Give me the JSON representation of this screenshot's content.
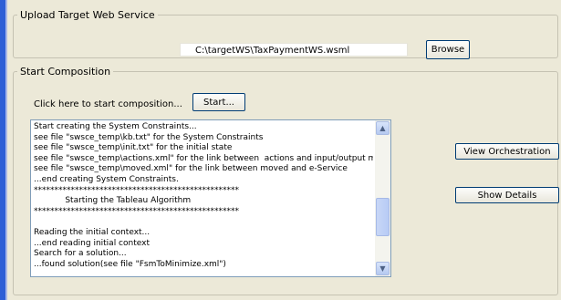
{
  "upload": {
    "legend": "Upload Target Web Service",
    "path_value": "C:\\targetWS\\TaxPaymentWS.wsml",
    "browse_label": "Browse"
  },
  "composition": {
    "legend": "Start Composition",
    "hint": "Click here to start composition...",
    "start_label": "Start...",
    "view_orchestration_label": "View Orchestration",
    "show_details_label": "Show Details",
    "log_lines": [
      "Start creating the System Constraints...",
      "see file \"swsce_temp\\kb.txt\" for the System Constraints",
      "see file \"swsce_temp\\init.txt\" for the initial state",
      "see file \"swsce_temp\\actions.xml\" for the link between  actions and input/output message",
      "see file \"swsce_temp\\moved.xml\" for the link between moved and e-Service",
      "...end creating System Constraints.",
      "**************************************************",
      "            Starting the Tableau Algorithm",
      "**************************************************",
      "",
      "Reading the initial context...",
      "...end reading initial context",
      "Search for a solution...",
      "...found solution(see file \"FsmToMinimize.xml\")"
    ]
  },
  "scrollbar": {
    "up_icon": "arrow-up",
    "down_icon": "arrow-down"
  }
}
